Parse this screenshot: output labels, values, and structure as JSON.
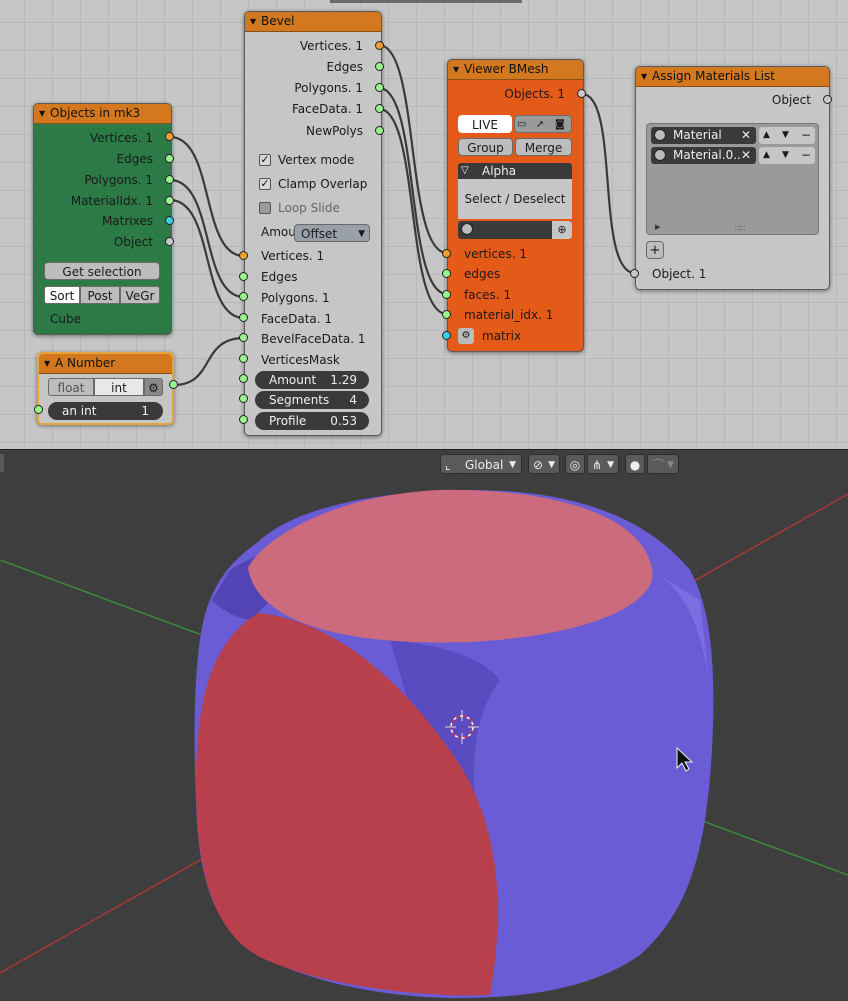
{
  "node_objects": {
    "title": "Objects in mk3",
    "outputs": [
      "Vertices. 1",
      "Edges",
      "Polygons. 1",
      "MaterialIdx. 1",
      "Matrixes",
      "Object"
    ],
    "get_selection_label": "Get selection",
    "sort_tabs": [
      "Sort",
      "Post",
      "VeGr"
    ],
    "object_name": "Cube",
    "colors": {
      "body": "#2c7a46"
    }
  },
  "node_number": {
    "title": "A Number",
    "mode_tabs": [
      "float",
      "int"
    ],
    "field_label": "an int",
    "field_value": "1"
  },
  "node_bevel": {
    "title": "Bevel",
    "outputs": [
      "Vertices. 1",
      "Edges",
      "Polygons. 1",
      "FaceData. 1",
      "NewPolys"
    ],
    "options": [
      {
        "label": "Vertex mode",
        "checked": true
      },
      {
        "label": "Clamp Overlap",
        "checked": true
      },
      {
        "label": "Loop Slide",
        "checked": false
      }
    ],
    "amount_label": "Amou",
    "amount_mode": "Offset",
    "inputs": [
      "Vertices. 1",
      "Edges",
      "Polygons. 1",
      "FaceData. 1",
      "BevelFaceData. 1",
      "VerticesMask"
    ],
    "sliders": [
      {
        "label": "Amount",
        "value": "1.29"
      },
      {
        "label": "Segments",
        "value": "4"
      },
      {
        "label": "Profile",
        "value": "0.53"
      }
    ]
  },
  "node_viewer": {
    "title": "Viewer BMesh",
    "output": "Objects. 1",
    "live_label": "LIVE",
    "group_label": "Group",
    "merge_label": "Merge",
    "alpha_label": "Alpha",
    "select_label": "Select / Deselect",
    "inputs": [
      "vertices. 1",
      "edges",
      "faces. 1",
      "material_idx. 1",
      "matrix"
    ],
    "colors": {
      "body": "#e45a18"
    }
  },
  "node_assign": {
    "title": "Assign Materials List",
    "output": "Object",
    "materials": [
      "Material",
      "Material.0.."
    ],
    "input": "Object. 1"
  },
  "viewport": {
    "orientation": "Global",
    "colors": {
      "red_face": "#b8404c",
      "pink_face": "#cc6a7e",
      "blue_face": "#6a5cd4",
      "axis_x": "#a83838",
      "axis_y": "#3a8a3a"
    }
  }
}
